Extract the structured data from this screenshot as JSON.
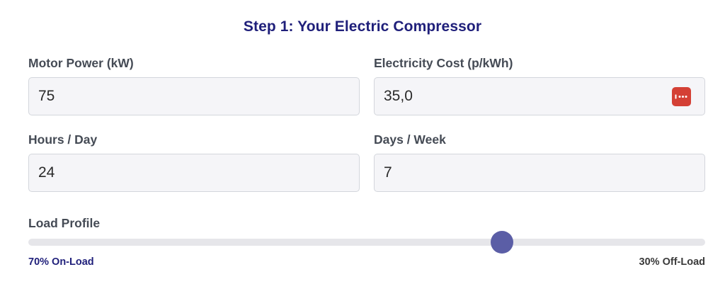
{
  "step": {
    "title": "Step 1: Your Electric Compressor"
  },
  "fields": {
    "motor_power": {
      "label": "Motor Power (kW)",
      "value": "75"
    },
    "electricity_cost": {
      "label": "Electricity Cost (p/kWh)",
      "value": "35,0",
      "autofill_icon": "password-manager-icon"
    },
    "hours_day": {
      "label": "Hours / Day",
      "value": "24"
    },
    "days_week": {
      "label": "Days / Week",
      "value": "7"
    }
  },
  "load_profile": {
    "label": "Load Profile",
    "on_load_label": "70% On-Load",
    "off_load_label": "30% Off-Load",
    "value_fraction": 0.7
  },
  "colors": {
    "title": "#1f1f7a",
    "label": "#454b55",
    "thumb": "#5b5ea6",
    "track": "#e6e6ea",
    "on_load": "#1f1f7a",
    "off_load": "#3a3a3a",
    "autofill_badge": "#d44035"
  }
}
